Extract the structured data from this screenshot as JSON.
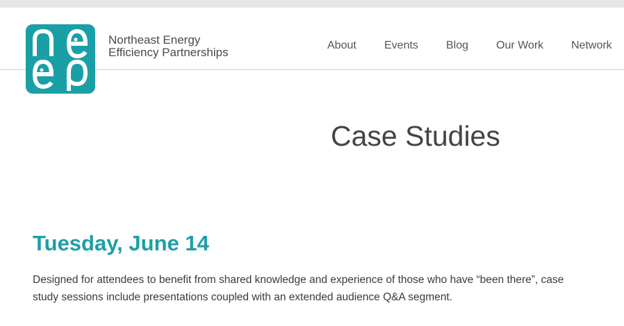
{
  "header": {
    "org_name_line1": "Northeast Energy",
    "org_name_line2": "Efficiency Partnerships",
    "logo_icon": "neep-logo",
    "logo_text": "neep",
    "brand_color": "#1a9fa7"
  },
  "nav": {
    "items": [
      {
        "label": "About"
      },
      {
        "label": "Events"
      },
      {
        "label": "Blog"
      },
      {
        "label": "Our Work"
      },
      {
        "label": "Network"
      }
    ]
  },
  "main": {
    "page_title": "Case Studies",
    "date_heading": "Tuesday, June 14",
    "description": "Designed for attendees to benefit from shared knowledge and experience of those who have “been there”, case study sessions include presentations coupled with an extended audience Q&A segment."
  }
}
